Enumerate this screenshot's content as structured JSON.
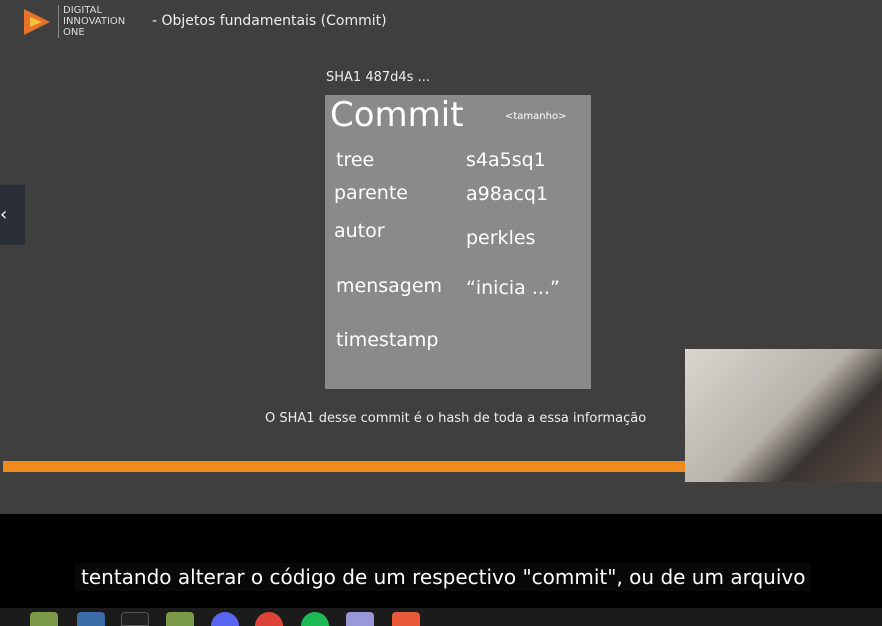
{
  "header": {
    "brand_lines": [
      "DIGITAL",
      "INNOVATION",
      "ONE"
    ],
    "title": "- Objetos fundamentais (Commit)"
  },
  "slide": {
    "sha": "SHA1 487d4s ...",
    "box_title": "Commit",
    "size": "<tamanho>",
    "fields": [
      {
        "k": "tree",
        "v": "s4a5sq1"
      },
      {
        "k": "parente",
        "v": "a98acq1"
      },
      {
        "k": "autor",
        "v": "perkles"
      },
      {
        "k": "mensagem",
        "v": "“inicia ...”"
      },
      {
        "k": "timestamp",
        "v": ""
      }
    ],
    "caption": "O SHA1 desse commit é o hash de toda a essa informação"
  },
  "progress": {
    "percent": 78
  },
  "subtitle": "tentando alterar o código de um respectivo \"commit\", ou de um arquivo",
  "taskbar": {
    "icons": [
      "files-icon",
      "screenshot-icon",
      "terminal-icon",
      "folder-icon",
      "discord-icon",
      "chrome-icon",
      "spotify-icon",
      "editor-icon",
      "app-icon"
    ]
  },
  "colors": {
    "accent": "#f08a1c"
  }
}
